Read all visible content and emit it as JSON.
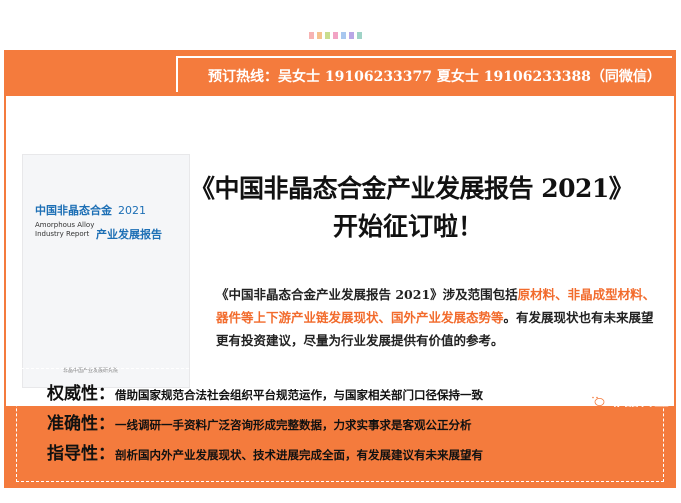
{
  "hotline": "预订热线：吴女士 19106233377    夏女士 19106233388（同微信）",
  "cover": {
    "title_cn": "中国非晶态合金",
    "year": "2021",
    "title_en_1": "Amorphous Alloy",
    "title_en_2": "Industry Report",
    "subtitle": "产业发展报告",
    "publisher": "非晶中国产业发展研究院"
  },
  "headline": {
    "line1": "《中国非晶态合金产业发展报告 2021》",
    "line2": "开始征订啦！"
  },
  "description": {
    "p1": "《中国非晶态合金产业发展报告 2021》涉及范围包括",
    "hl1": "原材料、非晶成型材料、器件等上下游产业链发展现状、国外产业发展态势等",
    "p2": "。有发展现状也有未来展望更有投资建议，尽量为行业发展提供有价值的参考。"
  },
  "features": [
    {
      "key": "权威性：",
      "value": "借助国家规范合法社会组织平台规范运作，与国家相关部门口径保持一致"
    },
    {
      "key": "准确性：",
      "value": "一线调研一手资料广泛咨询形成完整数据，力求实事求是客观公正分析"
    },
    {
      "key": "指导性：",
      "value": "剖析国内外产业发展现状、技术进展完成全面，有发展建议有未来展望有"
    }
  ],
  "watermark": "非晶合金",
  "colors": {
    "orange": "#f47b3d",
    "highlight": "#f26b2c",
    "blue": "#1d6fb5"
  }
}
